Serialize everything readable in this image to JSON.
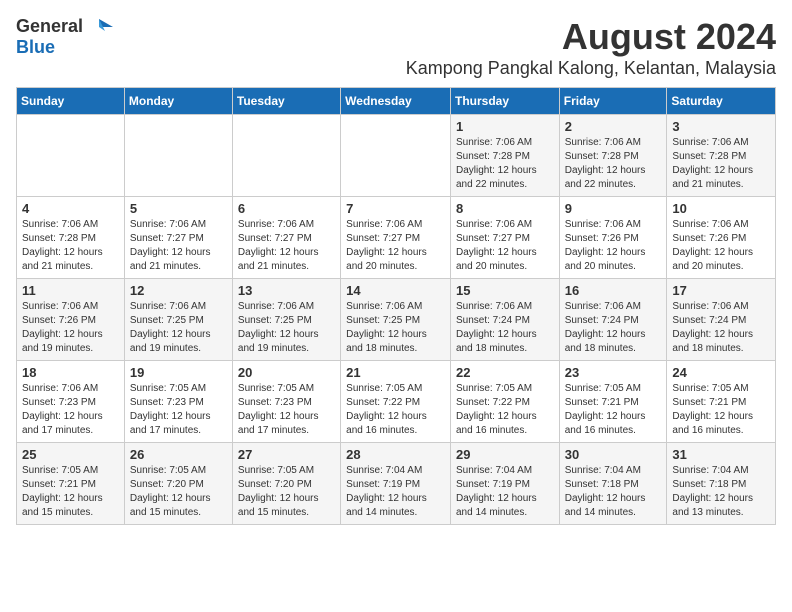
{
  "header": {
    "logo_general": "General",
    "logo_blue": "Blue",
    "month_title": "August 2024",
    "location": "Kampong Pangkal Kalong, Kelantan, Malaysia"
  },
  "days_of_week": [
    "Sunday",
    "Monday",
    "Tuesday",
    "Wednesday",
    "Thursday",
    "Friday",
    "Saturday"
  ],
  "weeks": [
    [
      {
        "day": "",
        "info": ""
      },
      {
        "day": "",
        "info": ""
      },
      {
        "day": "",
        "info": ""
      },
      {
        "day": "",
        "info": ""
      },
      {
        "day": "1",
        "info": "Sunrise: 7:06 AM\nSunset: 7:28 PM\nDaylight: 12 hours\nand 22 minutes."
      },
      {
        "day": "2",
        "info": "Sunrise: 7:06 AM\nSunset: 7:28 PM\nDaylight: 12 hours\nand 22 minutes."
      },
      {
        "day": "3",
        "info": "Sunrise: 7:06 AM\nSunset: 7:28 PM\nDaylight: 12 hours\nand 21 minutes."
      }
    ],
    [
      {
        "day": "4",
        "info": "Sunrise: 7:06 AM\nSunset: 7:28 PM\nDaylight: 12 hours\nand 21 minutes."
      },
      {
        "day": "5",
        "info": "Sunrise: 7:06 AM\nSunset: 7:27 PM\nDaylight: 12 hours\nand 21 minutes."
      },
      {
        "day": "6",
        "info": "Sunrise: 7:06 AM\nSunset: 7:27 PM\nDaylight: 12 hours\nand 21 minutes."
      },
      {
        "day": "7",
        "info": "Sunrise: 7:06 AM\nSunset: 7:27 PM\nDaylight: 12 hours\nand 20 minutes."
      },
      {
        "day": "8",
        "info": "Sunrise: 7:06 AM\nSunset: 7:27 PM\nDaylight: 12 hours\nand 20 minutes."
      },
      {
        "day": "9",
        "info": "Sunrise: 7:06 AM\nSunset: 7:26 PM\nDaylight: 12 hours\nand 20 minutes."
      },
      {
        "day": "10",
        "info": "Sunrise: 7:06 AM\nSunset: 7:26 PM\nDaylight: 12 hours\nand 20 minutes."
      }
    ],
    [
      {
        "day": "11",
        "info": "Sunrise: 7:06 AM\nSunset: 7:26 PM\nDaylight: 12 hours\nand 19 minutes."
      },
      {
        "day": "12",
        "info": "Sunrise: 7:06 AM\nSunset: 7:25 PM\nDaylight: 12 hours\nand 19 minutes."
      },
      {
        "day": "13",
        "info": "Sunrise: 7:06 AM\nSunset: 7:25 PM\nDaylight: 12 hours\nand 19 minutes."
      },
      {
        "day": "14",
        "info": "Sunrise: 7:06 AM\nSunset: 7:25 PM\nDaylight: 12 hours\nand 18 minutes."
      },
      {
        "day": "15",
        "info": "Sunrise: 7:06 AM\nSunset: 7:24 PM\nDaylight: 12 hours\nand 18 minutes."
      },
      {
        "day": "16",
        "info": "Sunrise: 7:06 AM\nSunset: 7:24 PM\nDaylight: 12 hours\nand 18 minutes."
      },
      {
        "day": "17",
        "info": "Sunrise: 7:06 AM\nSunset: 7:24 PM\nDaylight: 12 hours\nand 18 minutes."
      }
    ],
    [
      {
        "day": "18",
        "info": "Sunrise: 7:06 AM\nSunset: 7:23 PM\nDaylight: 12 hours\nand 17 minutes."
      },
      {
        "day": "19",
        "info": "Sunrise: 7:05 AM\nSunset: 7:23 PM\nDaylight: 12 hours\nand 17 minutes."
      },
      {
        "day": "20",
        "info": "Sunrise: 7:05 AM\nSunset: 7:23 PM\nDaylight: 12 hours\nand 17 minutes."
      },
      {
        "day": "21",
        "info": "Sunrise: 7:05 AM\nSunset: 7:22 PM\nDaylight: 12 hours\nand 16 minutes."
      },
      {
        "day": "22",
        "info": "Sunrise: 7:05 AM\nSunset: 7:22 PM\nDaylight: 12 hours\nand 16 minutes."
      },
      {
        "day": "23",
        "info": "Sunrise: 7:05 AM\nSunset: 7:21 PM\nDaylight: 12 hours\nand 16 minutes."
      },
      {
        "day": "24",
        "info": "Sunrise: 7:05 AM\nSunset: 7:21 PM\nDaylight: 12 hours\nand 16 minutes."
      }
    ],
    [
      {
        "day": "25",
        "info": "Sunrise: 7:05 AM\nSunset: 7:21 PM\nDaylight: 12 hours\nand 15 minutes."
      },
      {
        "day": "26",
        "info": "Sunrise: 7:05 AM\nSunset: 7:20 PM\nDaylight: 12 hours\nand 15 minutes."
      },
      {
        "day": "27",
        "info": "Sunrise: 7:05 AM\nSunset: 7:20 PM\nDaylight: 12 hours\nand 15 minutes."
      },
      {
        "day": "28",
        "info": "Sunrise: 7:04 AM\nSunset: 7:19 PM\nDaylight: 12 hours\nand 14 minutes."
      },
      {
        "day": "29",
        "info": "Sunrise: 7:04 AM\nSunset: 7:19 PM\nDaylight: 12 hours\nand 14 minutes."
      },
      {
        "day": "30",
        "info": "Sunrise: 7:04 AM\nSunset: 7:18 PM\nDaylight: 12 hours\nand 14 minutes."
      },
      {
        "day": "31",
        "info": "Sunrise: 7:04 AM\nSunset: 7:18 PM\nDaylight: 12 hours\nand 13 minutes."
      }
    ]
  ]
}
